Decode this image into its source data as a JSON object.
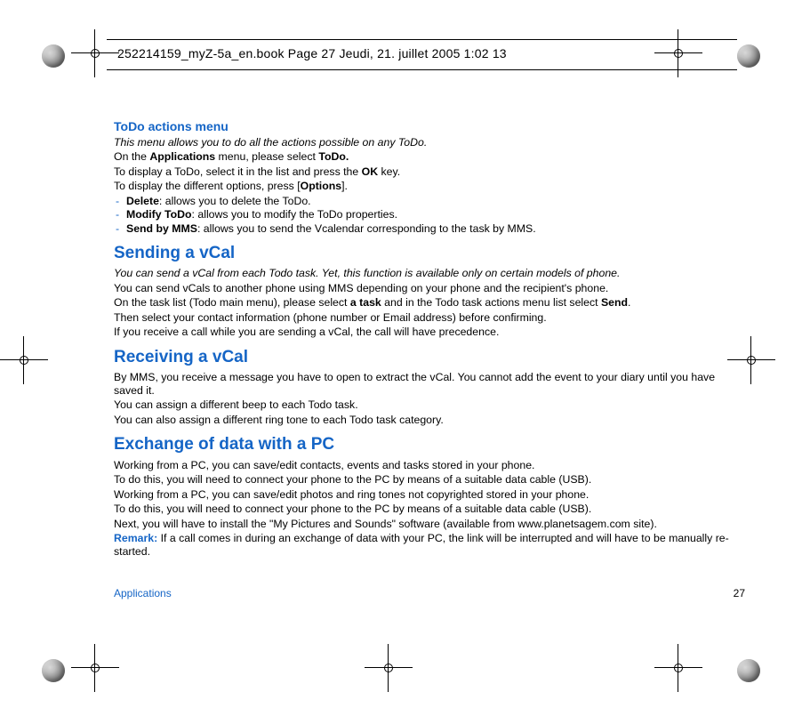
{
  "header": {
    "runner": "252214159_myZ-5a_en.book  Page 27  Jeudi, 21. juillet 2005  1:02 13"
  },
  "sections": {
    "todo": {
      "title": "ToDo actions menu",
      "intro": "This menu allows you to do all the actions possible on any ToDo.",
      "p1_pre": "On the ",
      "p1_b1": "Applications",
      "p1_mid": " menu, please select ",
      "p1_b2": "ToDo.",
      "p2_pre": "To display a ToDo, select it in the list and press the ",
      "p2_b": "OK",
      "p2_post": " key.",
      "p3_pre": "To display the different options, press [",
      "p3_b": "Options",
      "p3_post": "].",
      "li1_b": "Delete",
      "li1_t": ": allows you to delete the ToDo.",
      "li2_b": "Modify ToDo",
      "li2_t": ": allows you to modify the ToDo properties.",
      "li3_b": "Send by MMS",
      "li3_t": ": allows you to send the Vcalendar corresponding to the task by MMS."
    },
    "send": {
      "title": "Sending a vCal",
      "intro": "You can send a vCal from each Todo task. Yet, this function is available only on certain models of phone.",
      "p1": "You can send vCals to another phone using MMS depending on your phone and the recipient's phone.",
      "p2_pre": "On the task list (Todo main menu), please select ",
      "p2_b1": "a task",
      "p2_mid": " and in the Todo task actions menu list select ",
      "p2_b2": "Send",
      "p2_post": ".",
      "p3": "Then select your contact information (phone number or Email address) before confirming.",
      "p4": "If you receive a call while you are sending a vCal, the call will have precedence."
    },
    "recv": {
      "title": "Receiving a vCal",
      "p1": "By MMS, you receive a message you have to open to extract the vCal. You cannot add the event to your diary until you have saved it.",
      "p2": "You can assign a different beep to each Todo task.",
      "p3": "You can also assign a different ring tone to each Todo task category."
    },
    "pc": {
      "title": "Exchange of data with a PC",
      "p1": "Working from a PC, you can save/edit contacts, events and tasks stored in your phone.",
      "p2": "To do this, you will need to connect your phone to the PC by means of a suitable data cable (USB).",
      "p3": "Working from a PC, you can save/edit photos and ring tones not copyrighted stored in your phone.",
      "p4": "To do this, you will need to connect your phone to the PC by means of a suitable data cable (USB).",
      "p5": "Next, you will have to install the \"My Pictures and Sounds\" software (available from www.planetsagem.com site).",
      "remark_label": "Remark:",
      "remark_text": " If a call comes in during an exchange of data with your PC, the link will be interrupted and will have to be manually re-started."
    }
  },
  "footer": {
    "section": "Applications",
    "page": "27"
  },
  "dash": "-"
}
